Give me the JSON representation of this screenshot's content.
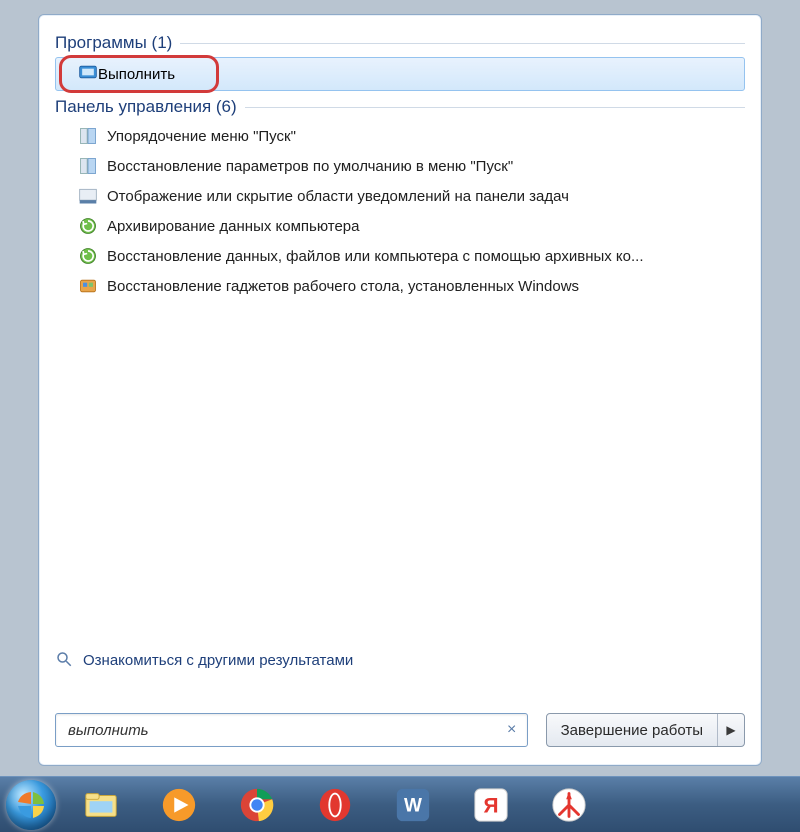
{
  "groups": {
    "programs": {
      "header": "Программы (1)",
      "items": [
        {
          "label": "Выполнить",
          "icon": "run-icon",
          "highlighted": true
        }
      ]
    },
    "control_panel": {
      "header": "Панель управления (6)",
      "items": [
        {
          "label": "Упорядочение меню \"Пуск\"",
          "icon": "startmenu-icon"
        },
        {
          "label": "Восстановление параметров по умолчанию в меню \"Пуск\"",
          "icon": "startmenu-icon"
        },
        {
          "label": "Отображение или скрытие области уведомлений на панели задач",
          "icon": "taskbar-icon"
        },
        {
          "label": "Архивирование данных компьютера",
          "icon": "backup-icon"
        },
        {
          "label": "Восстановление данных, файлов или компьютера с помощью архивных ко...",
          "icon": "backup-icon"
        },
        {
          "label": "Восстановление гаджетов рабочего стола, установленных Windows",
          "icon": "gadget-icon"
        }
      ]
    }
  },
  "more_results_label": "Ознакомиться с другими результатами",
  "search": {
    "value": "выполнить"
  },
  "shutdown_label": "Завершение работы",
  "taskbar": {
    "items": [
      {
        "name": "start-button"
      },
      {
        "name": "file-explorer"
      },
      {
        "name": "media-player"
      },
      {
        "name": "chrome"
      },
      {
        "name": "opera"
      },
      {
        "name": "vk"
      },
      {
        "name": "yandex-alt"
      },
      {
        "name": "yandex"
      }
    ]
  }
}
